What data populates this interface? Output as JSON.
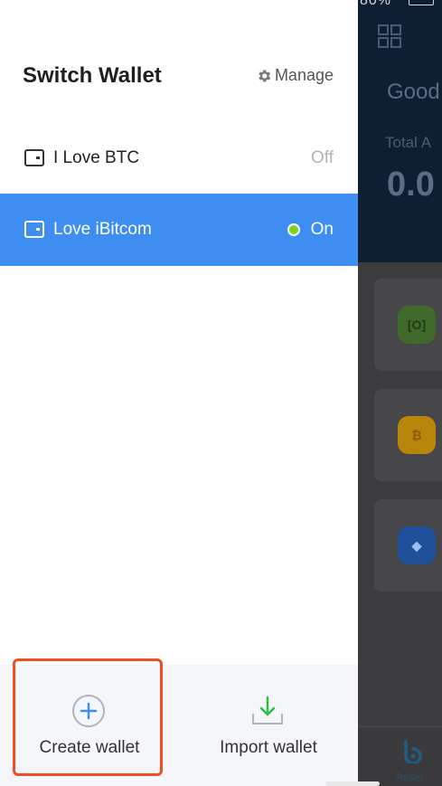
{
  "drawer": {
    "title": "Switch Wallet",
    "manage_label": "Manage",
    "wallets": [
      {
        "name": "I Love BTC",
        "status": "Off",
        "active": false
      },
      {
        "name": "Love iBitcom",
        "status": "On",
        "active": true
      }
    ],
    "footer": {
      "create_label": "Create wallet",
      "import_label": "Import wallet"
    }
  },
  "background": {
    "status_fragment": "80%",
    "greeting": "Good",
    "total_label": "Total A",
    "balance": "0.0",
    "tab_label": "Asset"
  },
  "colors": {
    "active_row": "#3d8ef0",
    "online_dot": "#7ed321",
    "highlight_border": "#f04e23",
    "create_icon": "#3d8ef0",
    "import_icon": "#2bbf4a"
  }
}
